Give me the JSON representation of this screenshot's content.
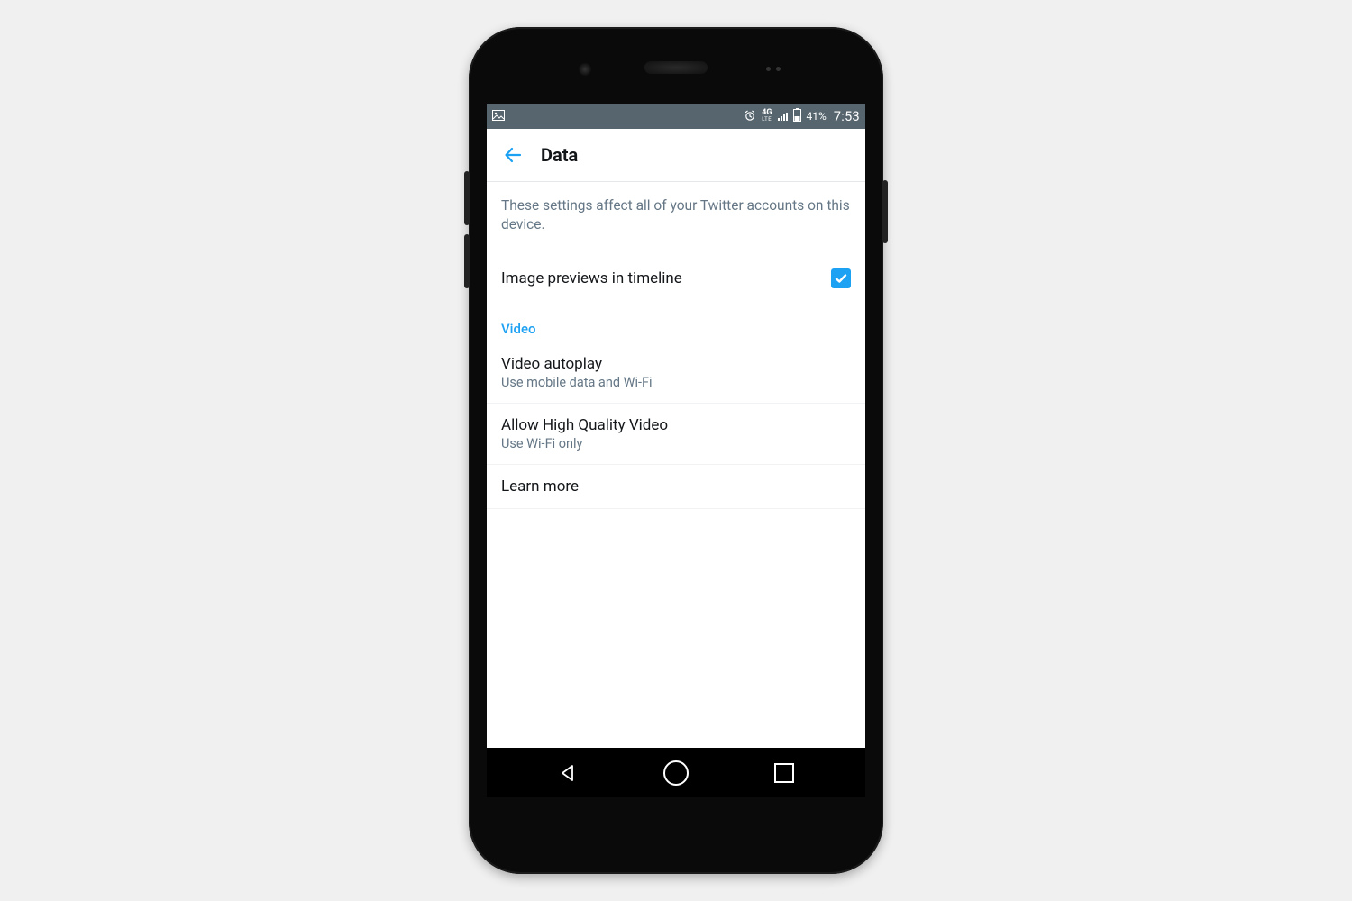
{
  "status": {
    "battery_pct": "41%",
    "time": "7:53",
    "network_label": "4G",
    "network_sub": "LTE"
  },
  "header": {
    "title": "Data"
  },
  "explain": "These settings affect all of your Twitter accounts on this device.",
  "image_previews": {
    "label": "Image previews in timeline",
    "checked": true
  },
  "video_section": {
    "header": "Video",
    "autoplay": {
      "title": "Video autoplay",
      "value": "Use mobile data and Wi-Fi"
    },
    "quality": {
      "title": "Allow High Quality Video",
      "value": "Use Wi-Fi only"
    },
    "learn_more": "Learn more"
  }
}
